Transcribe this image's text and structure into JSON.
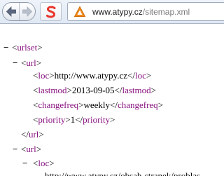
{
  "browser": {
    "url_domain": "www.atypy.cz",
    "url_path": "/sitemap.xml",
    "icons": {
      "back": "back-arrow-icon",
      "forward": "forward-arrow-icon",
      "app": "red-s-logo-icon",
      "site": "orange-triangle-site-icon"
    },
    "accent_color": "#e8342b",
    "site_color": "#f08a1c"
  },
  "xml": {
    "toggle": "−",
    "urlset_tag": "urlset",
    "url_tag": "url",
    "loc_tag": "loc",
    "lastmod_tag": "lastmod",
    "changefreq_tag": "changefreq",
    "priority_tag": "priority",
    "entries": [
      {
        "loc": "http://www.atypy.cz",
        "lastmod": "2013-09-05",
        "changefreq": "weekly",
        "priority": "1"
      },
      {
        "loc": "http://www.atypy.cz/obsah-stranek/problas"
      }
    ],
    "tag_color": "#881280"
  }
}
